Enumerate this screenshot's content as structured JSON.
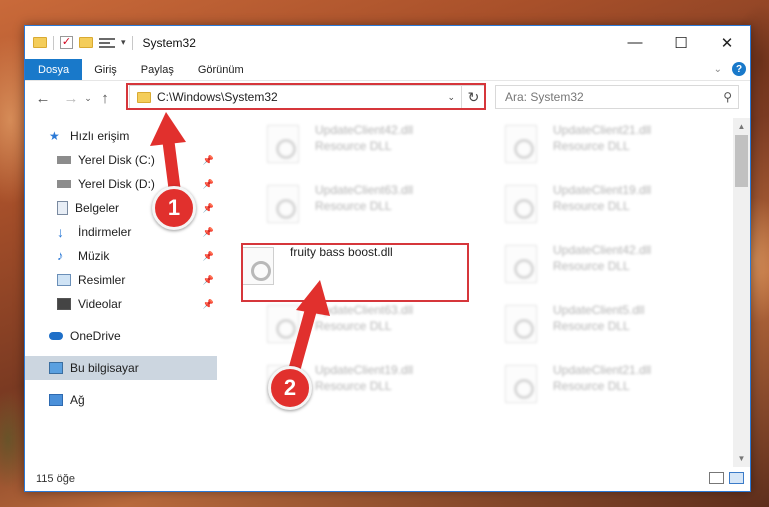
{
  "window": {
    "title": "System32",
    "minimize_glyph": "—",
    "maximize_glyph": "☐",
    "close_glyph": "✕"
  },
  "ribbon": {
    "tabs": [
      "Dosya",
      "Giriş",
      "Paylaş",
      "Görünüm"
    ]
  },
  "address": {
    "path": "C:\\Windows\\System32",
    "refresh_glyph": "↻",
    "dropdown_glyph": "⌄"
  },
  "search": {
    "placeholder": "Ara: System32"
  },
  "sidebar": {
    "items": [
      {
        "label": "Hızlı erişim",
        "icon": "star-icon"
      },
      {
        "label": "Yerel Disk (C:)",
        "icon": "drive-icon",
        "pinned": true
      },
      {
        "label": "Yerel Disk (D:)",
        "icon": "drive-icon",
        "pinned": true
      },
      {
        "label": "Belgeler",
        "icon": "documents-icon",
        "pinned": true
      },
      {
        "label": "İndirmeler",
        "icon": "download-icon",
        "pinned": true
      },
      {
        "label": "Müzik",
        "icon": "music-icon",
        "pinned": true
      },
      {
        "label": "Resimler",
        "icon": "pictures-icon",
        "pinned": true
      },
      {
        "label": "Videolar",
        "icon": "video-icon",
        "pinned": true
      },
      {
        "label": "OneDrive",
        "icon": "cloud-icon"
      },
      {
        "label": "Bu bilgisayar",
        "icon": "computer-icon",
        "selected": true
      },
      {
        "label": "Ağ",
        "icon": "network-icon"
      }
    ]
  },
  "files": {
    "left": [
      {
        "name": "UpdateClient42.dll",
        "desc": "Resource DLL"
      },
      {
        "name": "UpdateClient63.dll",
        "desc": "Resource DLL"
      },
      {
        "name": "fruity bass boost.dll",
        "desc": ""
      },
      {
        "name": "UpdateClient63.dll",
        "desc": "Resource DLL"
      },
      {
        "name": "UpdateClient19.dll",
        "desc": "Resource DLL"
      }
    ],
    "right": [
      {
        "name": "UpdateClient21.dll",
        "desc": "Resource DLL"
      },
      {
        "name": "UpdateClient19.dll",
        "desc": "Resource DLL"
      },
      {
        "name": "UpdateClient42.dll",
        "desc": "Resource DLL"
      },
      {
        "name": "UpdateClient5.dll",
        "desc": "Resource DLL"
      },
      {
        "name": "UpdateClient21.dll",
        "desc": "Resource DLL"
      }
    ]
  },
  "status": {
    "item_count": "115 öğe"
  },
  "annotations": {
    "badge_1": "1",
    "badge_2": "2",
    "highlight_color": "#d6363b",
    "badge_color": "#e1302d"
  },
  "colors": {
    "accent": "#1979ca",
    "selection": "#ccd6e0"
  }
}
